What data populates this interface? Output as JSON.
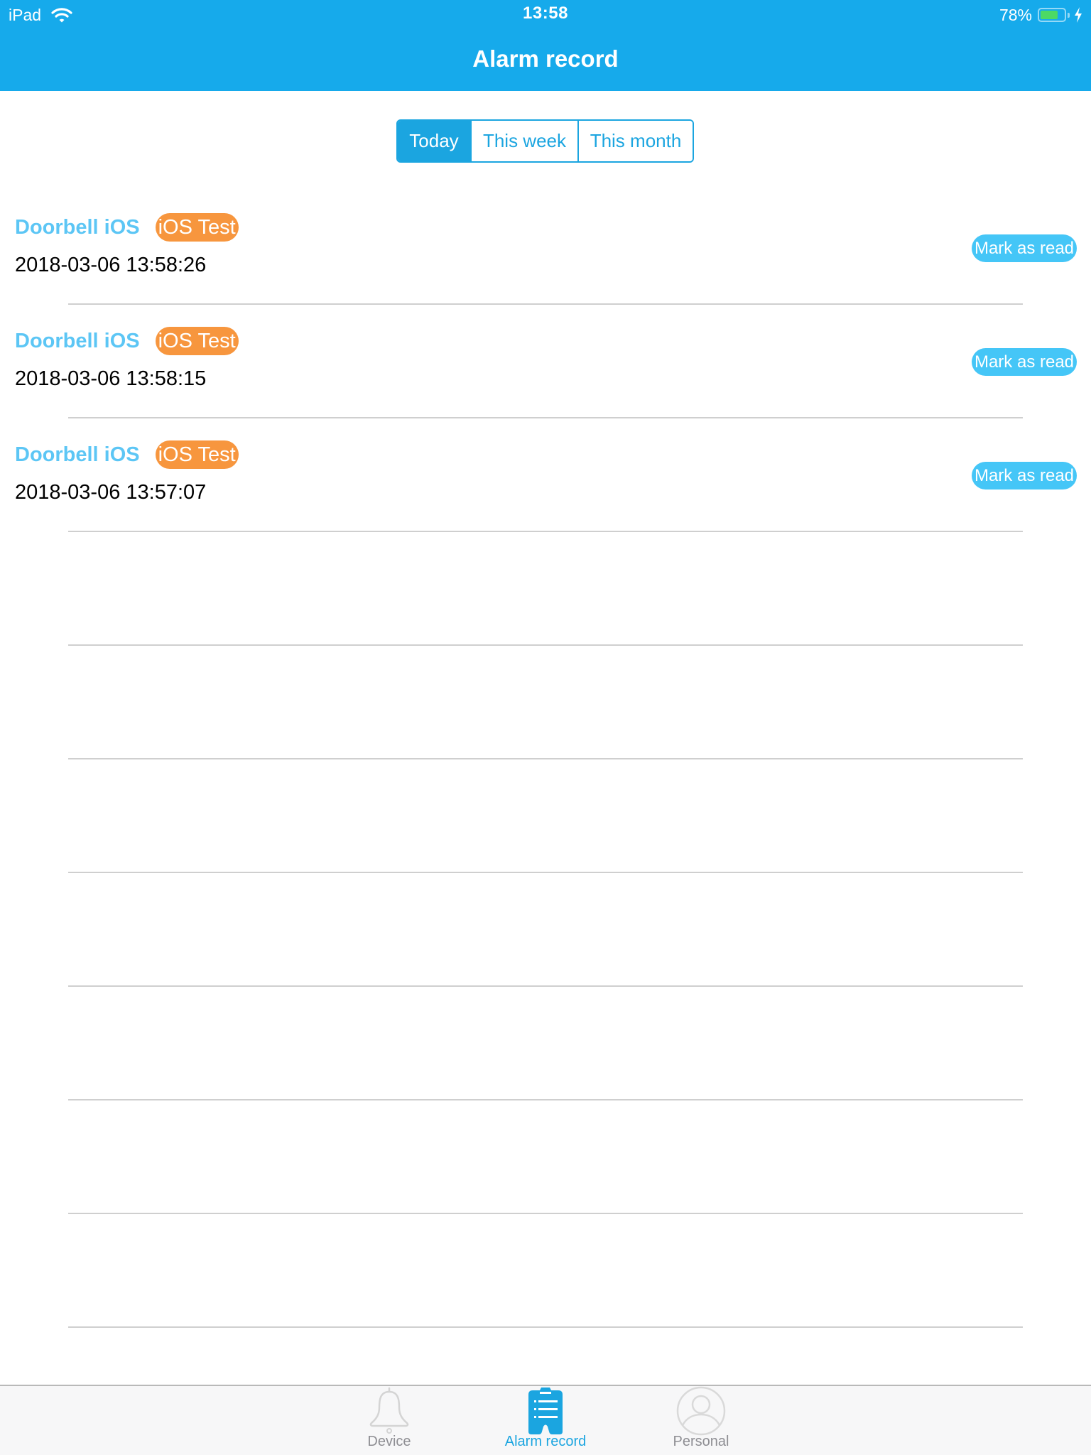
{
  "status_bar": {
    "device": "iPad",
    "time": "13:58",
    "battery_percent_label": "78%",
    "battery_level": 0.78,
    "charging": true,
    "wifi_icon": "wifi-icon",
    "battery_icon": "battery-icon",
    "charging_icon": "bolt-icon"
  },
  "nav": {
    "title": "Alarm record"
  },
  "filter": {
    "segments": [
      {
        "label": "Today",
        "active": true
      },
      {
        "label": "This week",
        "active": false
      },
      {
        "label": "This month",
        "active": false
      }
    ]
  },
  "records": [
    {
      "device": "Doorbell iOS",
      "badge": "iOS Test",
      "datetime": "2018-03-06 13:58:26",
      "action": "Mark as read"
    },
    {
      "device": "Doorbell iOS",
      "badge": "iOS Test",
      "datetime": "2018-03-06 13:58:15",
      "action": "Mark as read"
    },
    {
      "device": "Doorbell iOS",
      "badge": "iOS Test",
      "datetime": "2018-03-06 13:57:07",
      "action": "Mark as read"
    }
  ],
  "tabbar": {
    "items": [
      {
        "label": "Device",
        "icon": "bell-icon",
        "active": false
      },
      {
        "label": "Alarm record",
        "icon": "clipboard-icon",
        "active": true
      },
      {
        "label": "Personal",
        "icon": "person-icon",
        "active": false
      }
    ]
  },
  "colors": {
    "brand": "#16aaeb",
    "accent": "#1ba5e0",
    "device_name": "#5cc6f5",
    "badge": "#f7963e",
    "mark_read": "#45c6f7",
    "battery": "#4cd964"
  }
}
